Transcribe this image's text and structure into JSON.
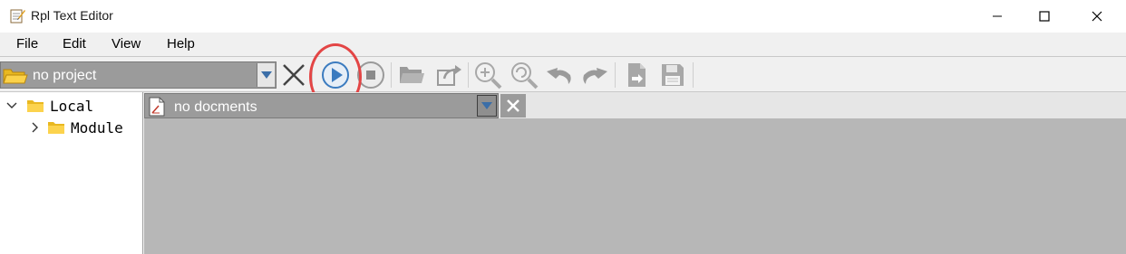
{
  "window": {
    "title": "Rpl Text Editor",
    "minimize_icon": "minimize-icon",
    "maximize_icon": "maximize-icon",
    "close_icon": "close-icon"
  },
  "menu": {
    "items": [
      "File",
      "Edit",
      "View",
      "Help"
    ]
  },
  "toolbar": {
    "project_selector": {
      "value": "no project",
      "icon": "folder-open-icon"
    },
    "buttons": [
      {
        "name": "close-project",
        "icon": "x-icon"
      },
      {
        "name": "run",
        "icon": "play-icon",
        "highlighted": true
      },
      {
        "name": "stop",
        "icon": "stop-icon"
      },
      {
        "name": "open",
        "icon": "folder-open-icon"
      },
      {
        "name": "export",
        "icon": "share-icon"
      },
      {
        "name": "zoom-in",
        "icon": "zoom-in-icon"
      },
      {
        "name": "zoom-reset",
        "icon": "zoom-reset-icon"
      },
      {
        "name": "undo",
        "icon": "undo-icon"
      },
      {
        "name": "redo",
        "icon": "redo-icon"
      },
      {
        "name": "import-file",
        "icon": "file-import-icon"
      },
      {
        "name": "save",
        "icon": "save-icon"
      }
    ],
    "highlight_color": "#e34545"
  },
  "tree": {
    "items": [
      {
        "label": "Local",
        "expanded": true
      },
      {
        "label": "Module",
        "expanded": false
      }
    ]
  },
  "documents": {
    "selector_value": "no docments",
    "icon": "document-icon",
    "close_icon": "close-document-icon"
  },
  "colors": {
    "accent_blue": "#3b7bbf",
    "folder_yellow": "#f5c211",
    "panel_gray": "#b7b7b7",
    "combo_gray": "#9b9b9b"
  }
}
